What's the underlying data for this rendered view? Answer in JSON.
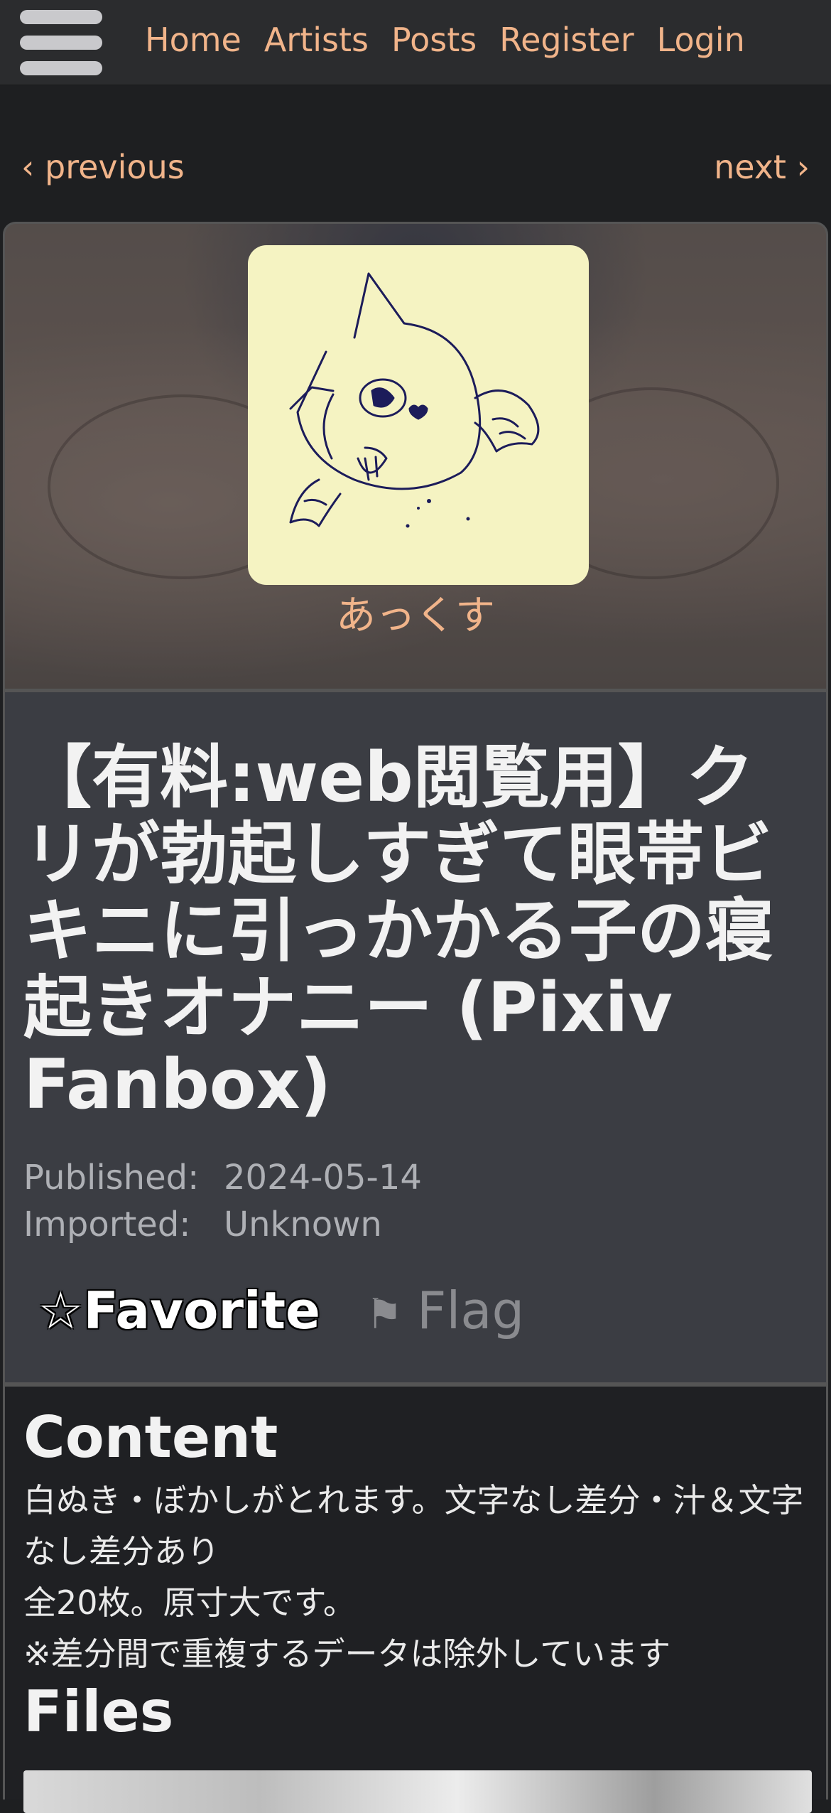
{
  "nav": {
    "menu_icon": "hamburger-menu-icon",
    "links": [
      "Home",
      "Artists",
      "Posts",
      "Register",
      "Login"
    ],
    "link_color": "#f1b48a"
  },
  "pager": {
    "previous": "‹ previous",
    "next": "next ›"
  },
  "artist": {
    "name": "あっくす",
    "avatar_icon": "cat-doodle-avatar"
  },
  "post": {
    "title": "【有料:web閲覧用】クリが勃起しすぎて眼帯ビキニに引っかかる子の寝起きオナニー (Pixiv Fanbox)",
    "published_label": "Published:",
    "published_value": "2024-05-14",
    "imported_label": "Imported:",
    "imported_value": "Unknown",
    "favorite_star": "☆",
    "favorite_label": "Favorite",
    "flag_icon": "⚑",
    "flag_label": "Flag"
  },
  "content": {
    "heading": "Content",
    "lines": [
      "白ぬき・ぼかしがとれます。文字なし差分・汁＆文字なし差分あり",
      "全20枚。原寸大です。",
      "※差分間で重複するデータは除外しています"
    ],
    "files_heading": "Files"
  }
}
